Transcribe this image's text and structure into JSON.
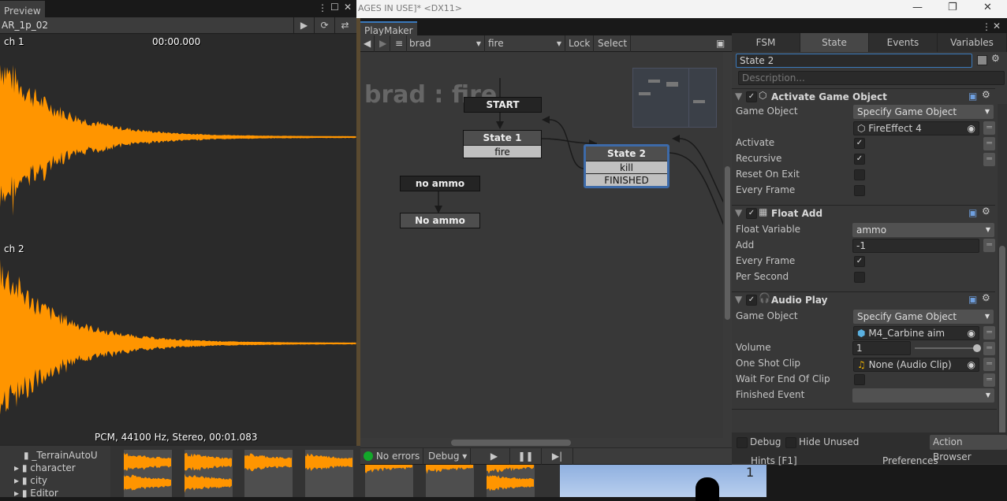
{
  "window": {
    "title": "[...AGES IN USE]* <DX11>",
    "title_visible": "AGES IN USE]* <DX11>"
  },
  "preview": {
    "tab": "Preview",
    "clip": "AR_1p_02",
    "ch1": "ch 1",
    "ch2": "ch 2",
    "time": "00:00.000",
    "info": "PCM, 44100 Hz, Stereo, 00:01.083",
    "wave_color": "#ff9500"
  },
  "project": {
    "folders": [
      "_TerrainAutoU",
      "character",
      "city",
      "Editor"
    ]
  },
  "playmaker": {
    "tab": "PlayMaker",
    "gameobject": "brad",
    "fsm": "fire",
    "lock": "Lock",
    "select": "Select",
    "graph_title": "brad : fire",
    "nodes": {
      "start": "START",
      "state1": "State 1",
      "state1_event": "fire",
      "state2": "State 2",
      "state2_e1": "kill",
      "state2_e2": "FINISHED",
      "noammo_event": "no ammo",
      "noammo_state": "No ammo"
    },
    "status": {
      "errors": "No errors",
      "debug": "Debug"
    },
    "bottom": {
      "debug": "Debug",
      "hide_unused": "Hide Unused",
      "action_browser": "Action Browser",
      "hints": "Hints [F1]",
      "preferences": "Preferences"
    }
  },
  "inspector": {
    "tabs": [
      "FSM",
      "State",
      "Events",
      "Variables"
    ],
    "active_tab": "State",
    "state_name": "State 2",
    "description_placeholder": "Description...",
    "actions": [
      {
        "name": "Activate Game Object",
        "game_object_label": "Game Object",
        "game_object_mode": "Specify Game Object",
        "game_object": "FireEffect 4",
        "activate": "Activate",
        "recursive": "Recursive",
        "reset_on_exit": "Reset On Exit",
        "every_frame": "Every Frame"
      },
      {
        "name": "Float Add",
        "float_variable_label": "Float Variable",
        "float_variable": "ammo",
        "add_label": "Add",
        "add": "-1",
        "every_frame": "Every Frame",
        "per_second": "Per Second"
      },
      {
        "name": "Audio Play",
        "game_object_label": "Game Object",
        "game_object_mode": "Specify Game Object",
        "game_object": "M4_Carbine aim",
        "volume_label": "Volume",
        "volume": "1",
        "clip_label": "One Shot Clip",
        "clip": "None (Audio Clip)",
        "wait_label": "Wait For End Of Clip",
        "finished_label": "Finished Event",
        "finished": ""
      }
    ]
  },
  "game_view": {
    "label": "1"
  }
}
